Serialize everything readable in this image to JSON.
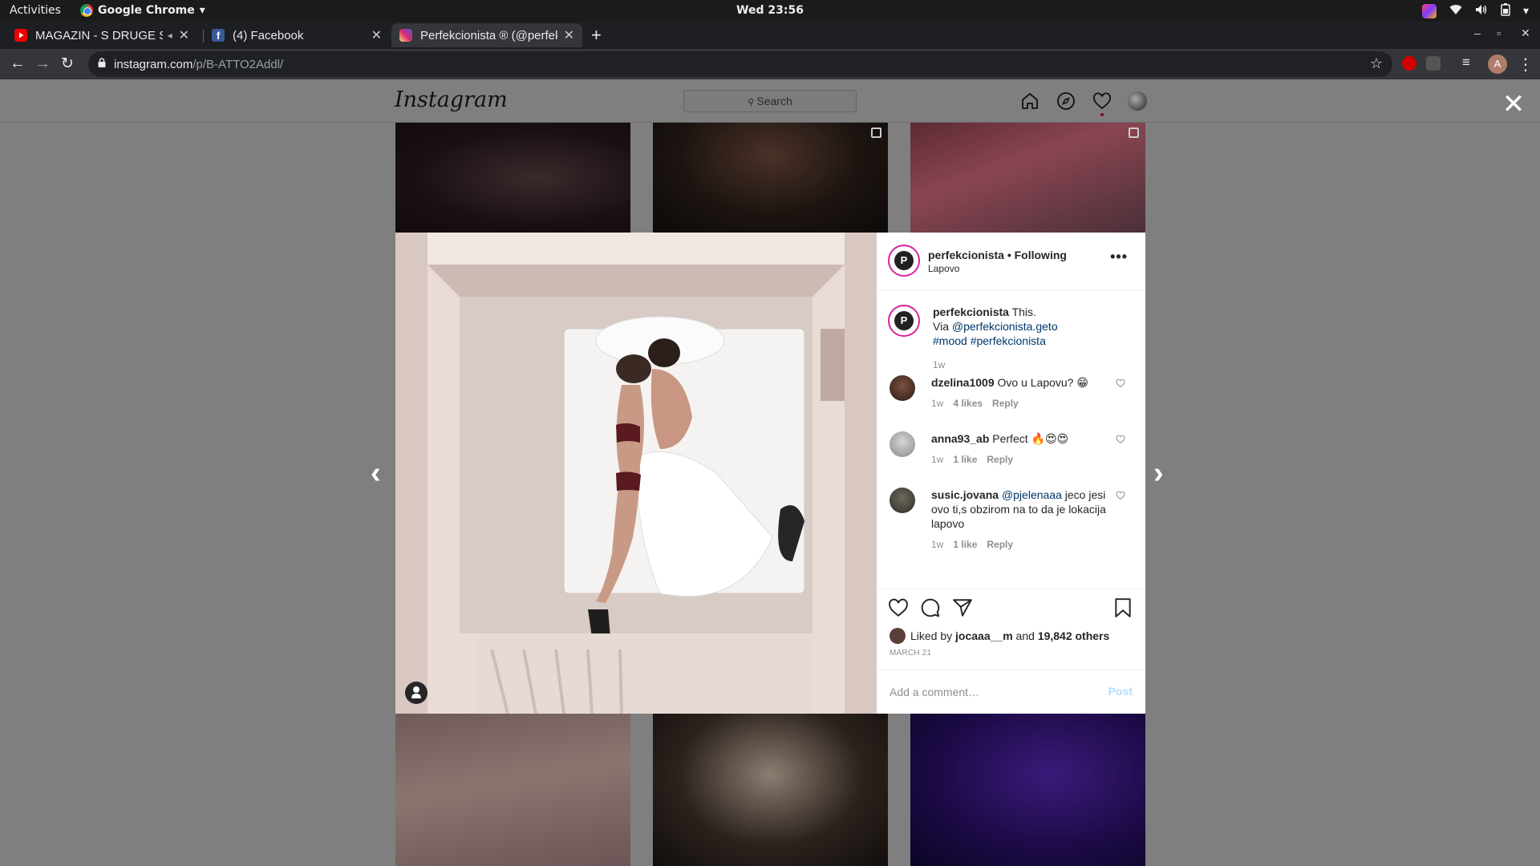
{
  "system_bar": {
    "activities": "Activities",
    "app_name": "Google Chrome",
    "clock": "Wed 23:56"
  },
  "browser": {
    "tabs": [
      {
        "title": "MAGAZIN - S DRUGE STRANE",
        "icon": "youtube-icon"
      },
      {
        "title": "(4) Facebook",
        "icon": "facebook-icon"
      },
      {
        "title": "Perfekcionista ® (@perfekcionista)",
        "icon": "instagram-icon",
        "active": true
      }
    ],
    "url_host": "instagram.com",
    "url_path": "/p/B-ATTO2Addl/",
    "profile_initial": "A"
  },
  "instagram": {
    "logo": "Instagram",
    "search_placeholder": "Search",
    "nav_icons": [
      "home-icon",
      "explore-icon",
      "activity-heart-icon",
      "profile-avatar-icon"
    ]
  },
  "post": {
    "author": "perfekcionista",
    "following": "Following",
    "location": "Lapovo",
    "caption": {
      "text": "This.",
      "via_prefix": "Via",
      "via_handle": "@perfekcionista.geto",
      "hashtags": "#mood #perfekcionista",
      "time": "1w"
    },
    "comments": [
      {
        "user": "dzelina1009",
        "text": "Ovo u Lapovu? 😁",
        "time": "1w",
        "likes": "4 likes",
        "reply": "Reply"
      },
      {
        "user": "anna93_ab",
        "text": "Perfect 🔥😍😍",
        "time": "1w",
        "likes": "1 like",
        "reply": "Reply"
      },
      {
        "user": "susic.jovana",
        "mention": "@pjelenaaa",
        "text": "jeco jesi ovo ti,s obzirom na to da je lokacija lapovo",
        "time": "1w",
        "likes": "1 like",
        "reply": "Reply"
      }
    ],
    "liked_by_prefix": "Liked by",
    "liked_by_user": "jocaaa__m",
    "liked_by_and": "and",
    "liked_by_others": "19,842 others",
    "date": "MARCH 21",
    "comment_placeholder": "Add a comment…",
    "post_button": "Post"
  }
}
